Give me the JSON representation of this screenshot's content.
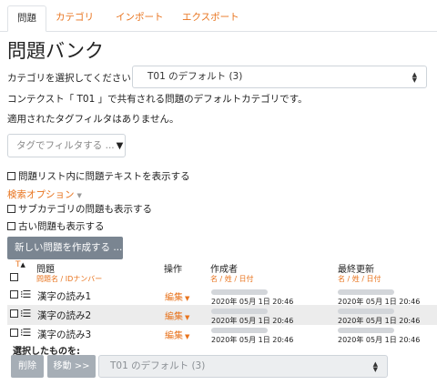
{
  "tabs": [
    {
      "label": "問題"
    },
    {
      "label": "カテゴリ"
    },
    {
      "label": "インポート"
    },
    {
      "label": "エクスポート"
    }
  ],
  "page_title": "問題バンク",
  "category": {
    "label": "カテゴリを選択してください:",
    "selected": "T01 のデフォルト (3)"
  },
  "context_info": "コンテクスト「 T01 」で共有される問題のデフォルトカテゴリです。",
  "tag_info": "適用されたタグフィルタはありません。",
  "tag_filter": {
    "placeholder": "タグでフィルタする ..."
  },
  "show_text_label": "問題リスト内に問題テキストを表示する",
  "search_options_label": "検索オプション",
  "show_subcategories_label": "サブカテゴリの問題も表示する",
  "show_old_label": "古い問題も表示する",
  "create_button": "新しい問題を作成する ...",
  "table": {
    "sort_marker": "T",
    "col_question": "問題",
    "col_question_sub": "問題名 / IDナンバー",
    "col_actions": "操作",
    "col_creator": "作成者",
    "col_creator_sub": "名 / 姓 / 日付",
    "col_modified": "最終更新",
    "col_modified_sub": "名 / 姓 / 日付",
    "rows": [
      {
        "name": "漢字の読み1",
        "action": "編集",
        "created": "2020年 05月 1日 20:46",
        "modified": "2020年 05月 1日 20:46"
      },
      {
        "name": "漢字の読み2",
        "action": "編集",
        "created": "2020年 05月 1日 20:46",
        "modified": "2020年 05月 1日 20:46"
      },
      {
        "name": "漢字の読み3",
        "action": "編集",
        "created": "2020年 05月 1日 20:46",
        "modified": "2020年 05月 1日 20:46"
      }
    ]
  },
  "bulk": {
    "label": "選択したものを:",
    "delete": "削除",
    "move": "移動 >>",
    "target": "T01 のデフォルト (3)"
  },
  "colors": {
    "accent": "#e8731d",
    "button": "#7a8591"
  }
}
